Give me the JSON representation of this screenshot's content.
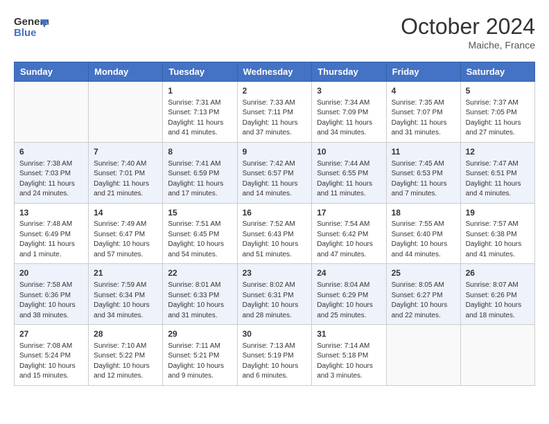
{
  "header": {
    "logo_general": "General",
    "logo_blue": "Blue",
    "month_title": "October 2024",
    "location": "Maiche, France"
  },
  "days_of_week": [
    "Sunday",
    "Monday",
    "Tuesday",
    "Wednesday",
    "Thursday",
    "Friday",
    "Saturday"
  ],
  "weeks": [
    [
      {
        "day": "",
        "sunrise": "",
        "sunset": "",
        "daylight": ""
      },
      {
        "day": "",
        "sunrise": "",
        "sunset": "",
        "daylight": ""
      },
      {
        "day": "1",
        "sunrise": "Sunrise: 7:31 AM",
        "sunset": "Sunset: 7:13 PM",
        "daylight": "Daylight: 11 hours and 41 minutes."
      },
      {
        "day": "2",
        "sunrise": "Sunrise: 7:33 AM",
        "sunset": "Sunset: 7:11 PM",
        "daylight": "Daylight: 11 hours and 37 minutes."
      },
      {
        "day": "3",
        "sunrise": "Sunrise: 7:34 AM",
        "sunset": "Sunset: 7:09 PM",
        "daylight": "Daylight: 11 hours and 34 minutes."
      },
      {
        "day": "4",
        "sunrise": "Sunrise: 7:35 AM",
        "sunset": "Sunset: 7:07 PM",
        "daylight": "Daylight: 11 hours and 31 minutes."
      },
      {
        "day": "5",
        "sunrise": "Sunrise: 7:37 AM",
        "sunset": "Sunset: 7:05 PM",
        "daylight": "Daylight: 11 hours and 27 minutes."
      }
    ],
    [
      {
        "day": "6",
        "sunrise": "Sunrise: 7:38 AM",
        "sunset": "Sunset: 7:03 PM",
        "daylight": "Daylight: 11 hours and 24 minutes."
      },
      {
        "day": "7",
        "sunrise": "Sunrise: 7:40 AM",
        "sunset": "Sunset: 7:01 PM",
        "daylight": "Daylight: 11 hours and 21 minutes."
      },
      {
        "day": "8",
        "sunrise": "Sunrise: 7:41 AM",
        "sunset": "Sunset: 6:59 PM",
        "daylight": "Daylight: 11 hours and 17 minutes."
      },
      {
        "day": "9",
        "sunrise": "Sunrise: 7:42 AM",
        "sunset": "Sunset: 6:57 PM",
        "daylight": "Daylight: 11 hours and 14 minutes."
      },
      {
        "day": "10",
        "sunrise": "Sunrise: 7:44 AM",
        "sunset": "Sunset: 6:55 PM",
        "daylight": "Daylight: 11 hours and 11 minutes."
      },
      {
        "day": "11",
        "sunrise": "Sunrise: 7:45 AM",
        "sunset": "Sunset: 6:53 PM",
        "daylight": "Daylight: 11 hours and 7 minutes."
      },
      {
        "day": "12",
        "sunrise": "Sunrise: 7:47 AM",
        "sunset": "Sunset: 6:51 PM",
        "daylight": "Daylight: 11 hours and 4 minutes."
      }
    ],
    [
      {
        "day": "13",
        "sunrise": "Sunrise: 7:48 AM",
        "sunset": "Sunset: 6:49 PM",
        "daylight": "Daylight: 11 hours and 1 minute."
      },
      {
        "day": "14",
        "sunrise": "Sunrise: 7:49 AM",
        "sunset": "Sunset: 6:47 PM",
        "daylight": "Daylight: 10 hours and 57 minutes."
      },
      {
        "day": "15",
        "sunrise": "Sunrise: 7:51 AM",
        "sunset": "Sunset: 6:45 PM",
        "daylight": "Daylight: 10 hours and 54 minutes."
      },
      {
        "day": "16",
        "sunrise": "Sunrise: 7:52 AM",
        "sunset": "Sunset: 6:43 PM",
        "daylight": "Daylight: 10 hours and 51 minutes."
      },
      {
        "day": "17",
        "sunrise": "Sunrise: 7:54 AM",
        "sunset": "Sunset: 6:42 PM",
        "daylight": "Daylight: 10 hours and 47 minutes."
      },
      {
        "day": "18",
        "sunrise": "Sunrise: 7:55 AM",
        "sunset": "Sunset: 6:40 PM",
        "daylight": "Daylight: 10 hours and 44 minutes."
      },
      {
        "day": "19",
        "sunrise": "Sunrise: 7:57 AM",
        "sunset": "Sunset: 6:38 PM",
        "daylight": "Daylight: 10 hours and 41 minutes."
      }
    ],
    [
      {
        "day": "20",
        "sunrise": "Sunrise: 7:58 AM",
        "sunset": "Sunset: 6:36 PM",
        "daylight": "Daylight: 10 hours and 38 minutes."
      },
      {
        "day": "21",
        "sunrise": "Sunrise: 7:59 AM",
        "sunset": "Sunset: 6:34 PM",
        "daylight": "Daylight: 10 hours and 34 minutes."
      },
      {
        "day": "22",
        "sunrise": "Sunrise: 8:01 AM",
        "sunset": "Sunset: 6:33 PM",
        "daylight": "Daylight: 10 hours and 31 minutes."
      },
      {
        "day": "23",
        "sunrise": "Sunrise: 8:02 AM",
        "sunset": "Sunset: 6:31 PM",
        "daylight": "Daylight: 10 hours and 28 minutes."
      },
      {
        "day": "24",
        "sunrise": "Sunrise: 8:04 AM",
        "sunset": "Sunset: 6:29 PM",
        "daylight": "Daylight: 10 hours and 25 minutes."
      },
      {
        "day": "25",
        "sunrise": "Sunrise: 8:05 AM",
        "sunset": "Sunset: 6:27 PM",
        "daylight": "Daylight: 10 hours and 22 minutes."
      },
      {
        "day": "26",
        "sunrise": "Sunrise: 8:07 AM",
        "sunset": "Sunset: 6:26 PM",
        "daylight": "Daylight: 10 hours and 18 minutes."
      }
    ],
    [
      {
        "day": "27",
        "sunrise": "Sunrise: 7:08 AM",
        "sunset": "Sunset: 5:24 PM",
        "daylight": "Daylight: 10 hours and 15 minutes."
      },
      {
        "day": "28",
        "sunrise": "Sunrise: 7:10 AM",
        "sunset": "Sunset: 5:22 PM",
        "daylight": "Daylight: 10 hours and 12 minutes."
      },
      {
        "day": "29",
        "sunrise": "Sunrise: 7:11 AM",
        "sunset": "Sunset: 5:21 PM",
        "daylight": "Daylight: 10 hours and 9 minutes."
      },
      {
        "day": "30",
        "sunrise": "Sunrise: 7:13 AM",
        "sunset": "Sunset: 5:19 PM",
        "daylight": "Daylight: 10 hours and 6 minutes."
      },
      {
        "day": "31",
        "sunrise": "Sunrise: 7:14 AM",
        "sunset": "Sunset: 5:18 PM",
        "daylight": "Daylight: 10 hours and 3 minutes."
      },
      {
        "day": "",
        "sunrise": "",
        "sunset": "",
        "daylight": ""
      },
      {
        "day": "",
        "sunrise": "",
        "sunset": "",
        "daylight": ""
      }
    ]
  ]
}
